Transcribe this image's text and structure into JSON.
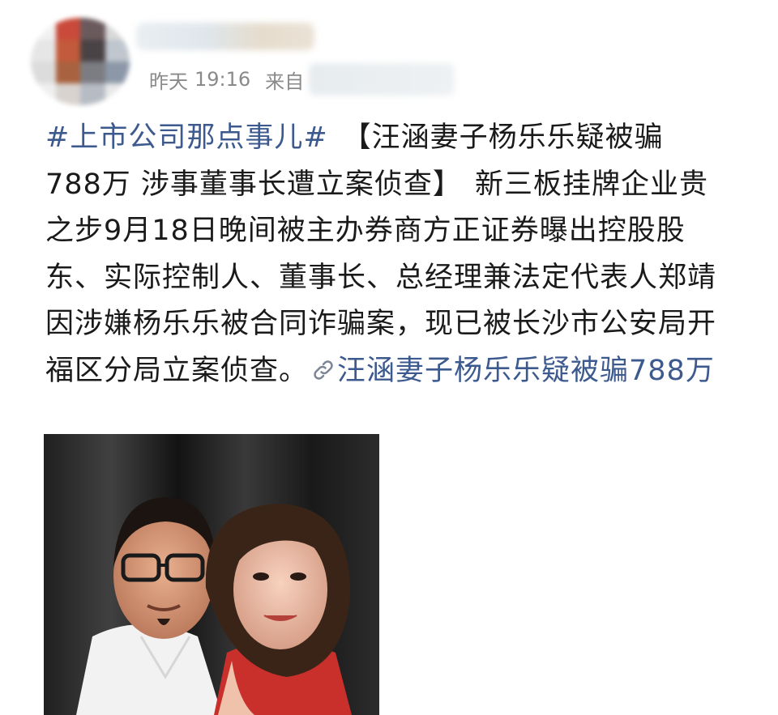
{
  "header": {
    "time_day": "昨天",
    "time_clock": "19:16",
    "source_prefix": "来自"
  },
  "post": {
    "hashtag": "#上市公司那点事儿#",
    "headline": "【汪涵妻子杨乐乐疑被骗788万 涉事董事长遭立案侦查】",
    "body": "新三板挂牌企业贵之步9月18日晚间被主办券商方正证券曝出控股股东、实际控制人、董事长、总经理兼法定代表人郑靖因涉嫌杨乐乐被合同诈骗案，现已被长沙市公安局开福区分局立案侦查。",
    "link_text": "汪涵妻子杨乐乐疑被骗788万"
  },
  "colors": {
    "link": "#3d5a8f",
    "meta_text": "#8a8a8a",
    "body_text": "#1a1a1a"
  },
  "icons": {
    "link": "link-chain-icon"
  }
}
